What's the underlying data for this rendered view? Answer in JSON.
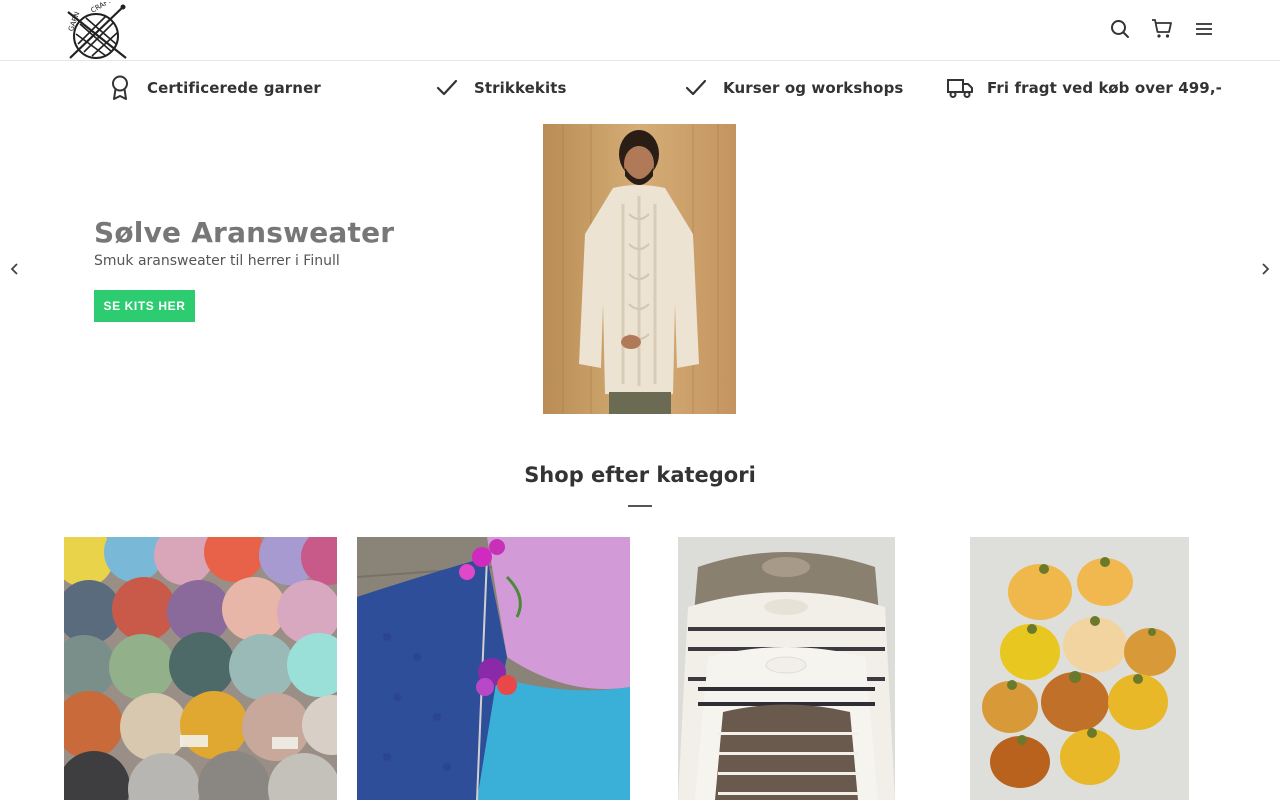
{
  "header": {
    "logo_text": "GARN & CRAFT",
    "icons": [
      "search-icon",
      "cart-icon",
      "menu-icon"
    ]
  },
  "usp": [
    {
      "icon": "award-icon",
      "label": "Certificerede garner"
    },
    {
      "icon": "check-icon",
      "label": "Strikkekits"
    },
    {
      "icon": "check-icon",
      "label": "Kurser og workshops"
    },
    {
      "icon": "truck-icon",
      "label": "Fri fragt ved køb over 499,-"
    }
  ],
  "hero": {
    "title": "Sølve Aransweater",
    "subtitle": "Smuk aransweater til herrer i Finull",
    "button_label": "SE KITS HER",
    "button_color": "#2ecc71"
  },
  "categories": {
    "title": "Shop efter kategori"
  }
}
